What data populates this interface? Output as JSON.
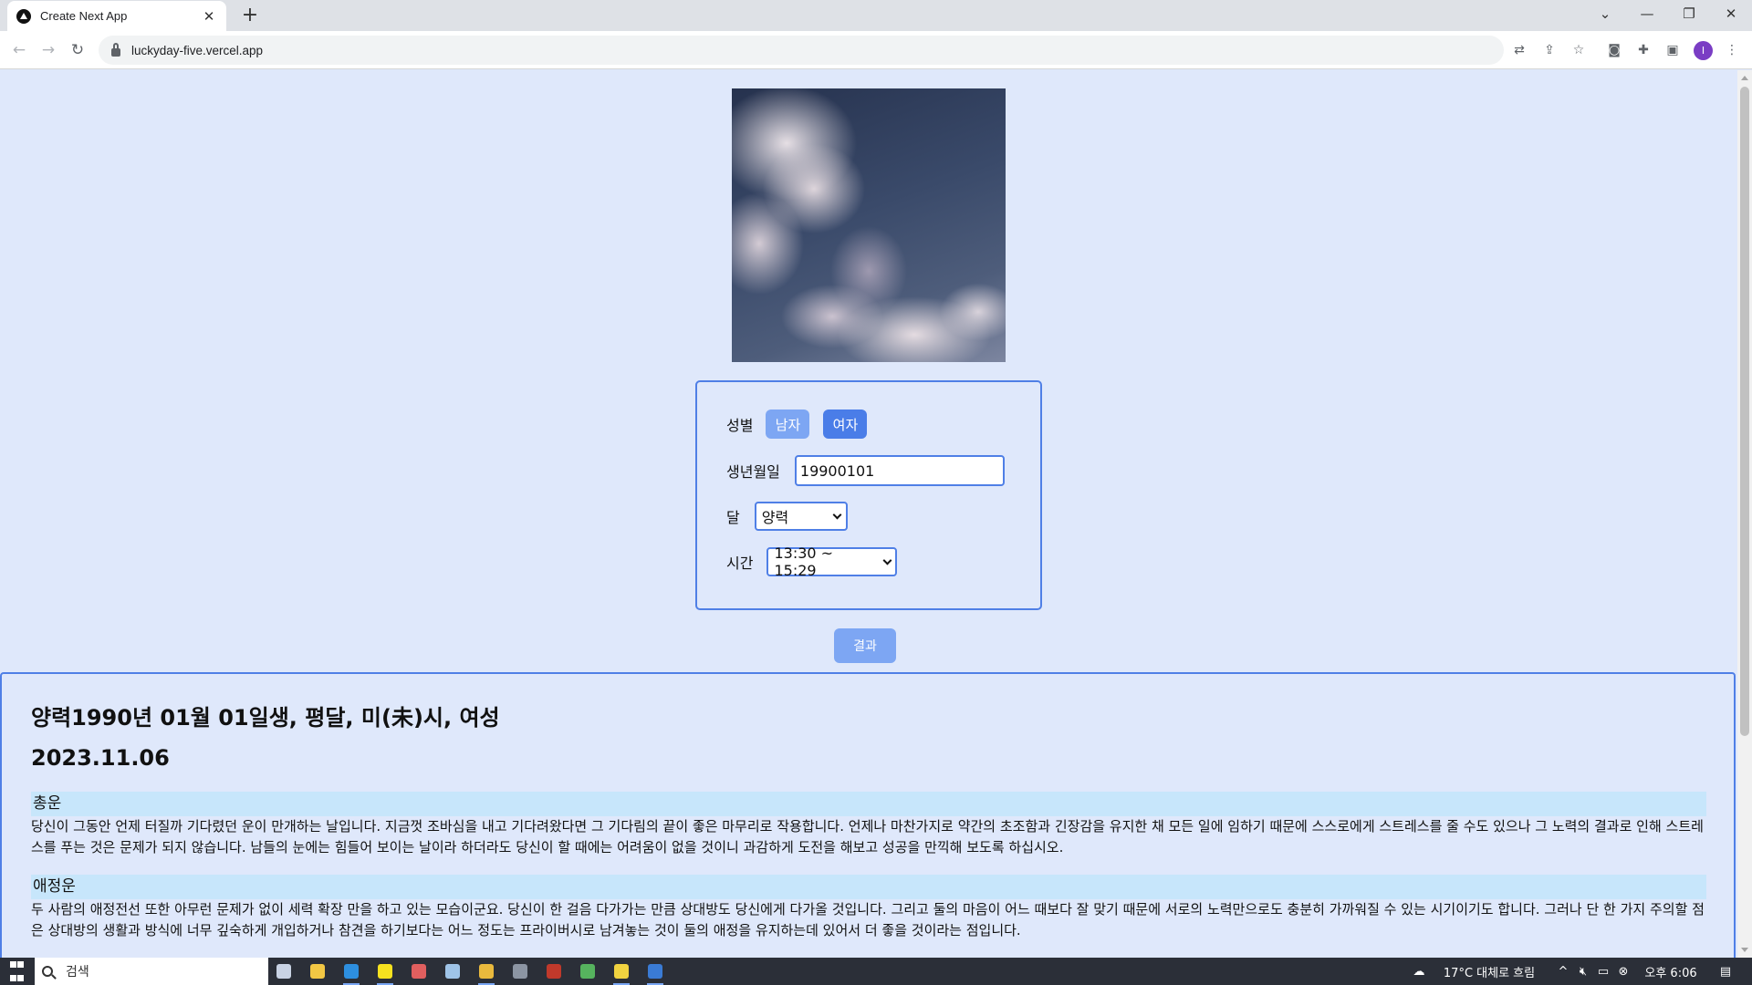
{
  "browser": {
    "tab_title": "Create Next App",
    "tab_close": "✕",
    "new_tab": "+",
    "url": "luckyday-five.vercel.app",
    "profile_initial": "I",
    "window_controls": {
      "list": "⌄",
      "minimize": "—",
      "restore": "❐",
      "close": "✕"
    }
  },
  "form": {
    "gender_label": "성별",
    "gender_options": [
      "남자",
      "여자"
    ],
    "gender_selected": "여자",
    "birth_label": "생년월일",
    "birth_value": "19900101",
    "calendar_label": "달",
    "calendar_value": "양력",
    "time_label": "시간",
    "time_value": "13:30 ~ 15:29",
    "result_button": "결과"
  },
  "result": {
    "headline": "양력1990년 01월 01일생, 평달, 미(未)시, 여성",
    "date": "2023.11.06",
    "sections": [
      {
        "title": "총운",
        "text": "당신이 그동안 언제 터질까 기다렸던 운이 만개하는 날입니다. 지금껏 조바심을 내고 기다려왔다면 그 기다림의 끝이 좋은 마무리로 작용합니다. 언제나 마찬가지로 약간의 초조함과 긴장감을 유지한 채 모든 일에 임하기 때문에 스스로에게 스트레스를 줄 수도 있으나 그 노력의 결과로 인해 스트레스를 푸는 것은 문제가 되지 않습니다. 남들의 눈에는 힘들어 보이는 날이라 하더라도 당신이 할 때에는 어려움이 없을 것이니 과감하게 도전을 해보고 성공을 만끽해 보도록 하십시오."
      },
      {
        "title": "애정운",
        "text": "두 사람의 애정전선 또한 아무런 문제가 없이 세력 확장 만을 하고 있는 모습이군요. 당신이 한 걸음 다가가는 만큼 상대방도 당신에게 다가올 것입니다. 그리고 둘의 마음이 어느 때보다 잘 맞기 때문에 서로의 노력만으로도 충분히 가까워질 수 있는 시기이기도 합니다. 그러나 단 한 가지 주의할 점은 상대방의 생활과 방식에 너무 깊숙하게 개입하거나 참견을 하기보다는 어느 정도는 프라이버시로 남겨놓는 것이 둘의 애정을 유지하는데 있어서 더 좋을 것이라는 점입니다."
      }
    ]
  },
  "taskbar": {
    "search_placeholder": "검색",
    "weather": "17°C  대체로 흐림",
    "clock": "오후 6:06",
    "apps": [
      {
        "name": "task-view-icon",
        "color": "#c9d3e4",
        "running": false
      },
      {
        "name": "file-explorer-icon",
        "color": "#f2c744",
        "running": false
      },
      {
        "name": "vscode-icon",
        "color": "#2d8fe0",
        "running": true
      },
      {
        "name": "kakaotalk-icon",
        "color": "#f7e21f",
        "running": true
      },
      {
        "name": "paint-icon",
        "color": "#e05f5f",
        "running": false
      },
      {
        "name": "notepad-icon",
        "color": "#9fc4e8",
        "running": false
      },
      {
        "name": "chrome-icon",
        "color": "#e9b93d",
        "running": true
      },
      {
        "name": "calculator-icon",
        "color": "#8c95a3",
        "running": false
      },
      {
        "name": "filezilla-icon",
        "color": "#c0392b",
        "running": false
      },
      {
        "name": "app-green-icon",
        "color": "#56b35e",
        "running": false
      },
      {
        "name": "sticky-notes-icon",
        "color": "#f1d340",
        "running": true
      },
      {
        "name": "terminal-icon",
        "color": "#3a7bd5",
        "running": true
      }
    ]
  },
  "colors": {
    "page_bg": "#dfe8fb",
    "accent": "#4f7fe6",
    "button_light": "#7da6f3",
    "button_active": "#4a7de8",
    "section_highlight": "#c7e6fb"
  }
}
